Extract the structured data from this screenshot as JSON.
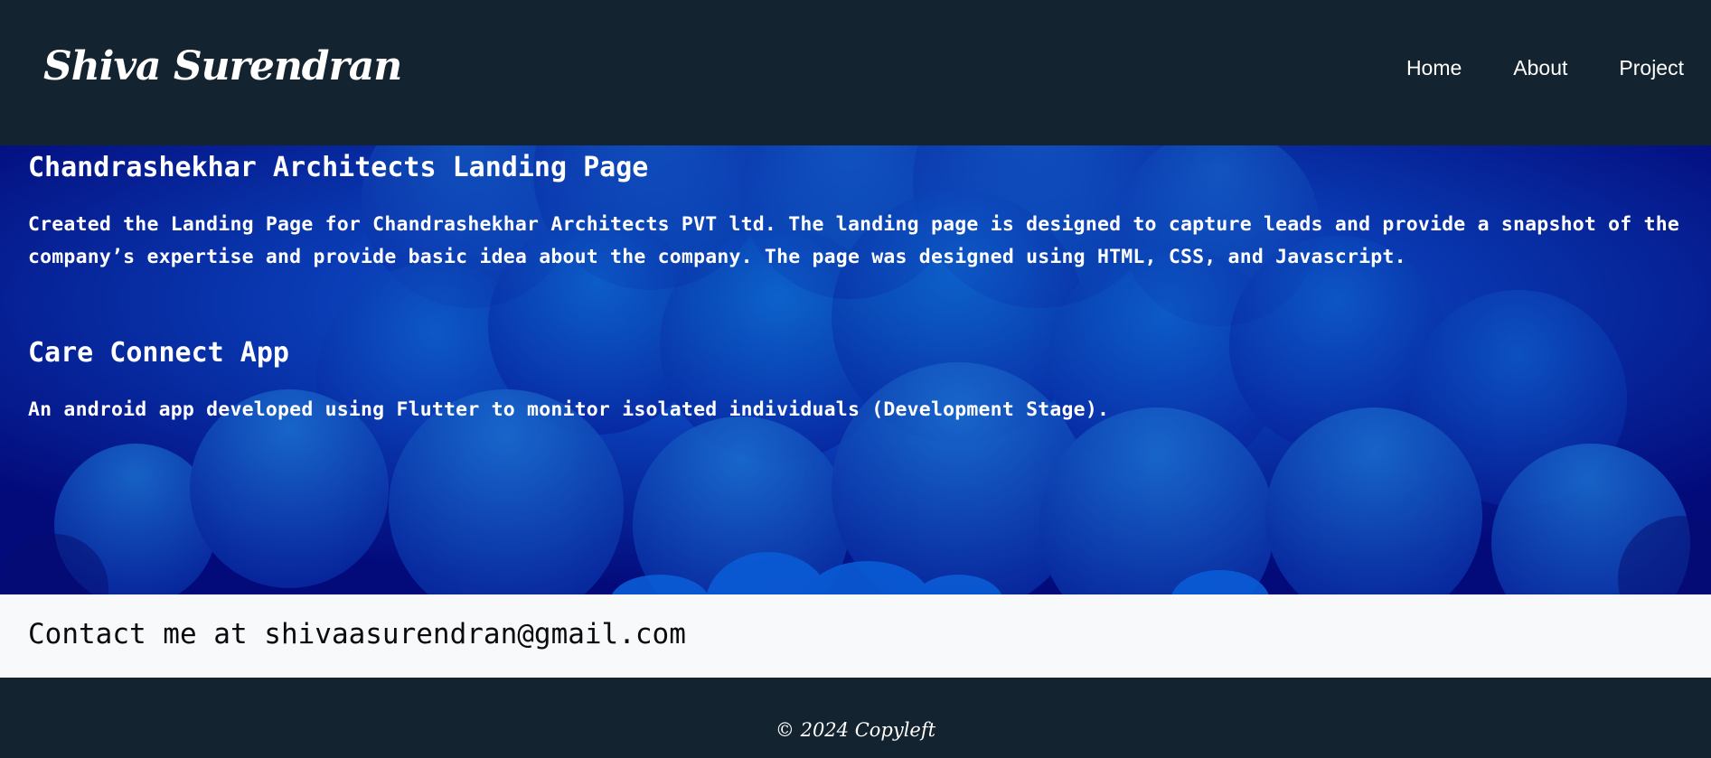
{
  "header": {
    "logo": "Shiva Surendran",
    "nav": [
      "Home",
      "About",
      "Project"
    ]
  },
  "projects": [
    {
      "title": "Chandrashekhar Architects Landing Page",
      "description": "Created the Landing Page for Chandrashekhar Architects PVT ltd. The landing page is designed to capture leads and provide a snapshot of the company’s expertise and provide basic idea about the company. The page was designed using HTML, CSS, and Javascript."
    },
    {
      "title": "Care Connect App",
      "description": "An android app developed using Flutter to monitor isolated individuals (Development Stage)."
    }
  ],
  "contact": {
    "text": "Contact me at shivaasurendran@gmail.com"
  },
  "footer": {
    "text": "© 2024 Copyleft"
  },
  "colors": {
    "header_bg": "#13232f",
    "hero_bg": "#040a8c",
    "cloud_light": "#0a6fc9",
    "contact_bg": "#f8f9fa"
  }
}
